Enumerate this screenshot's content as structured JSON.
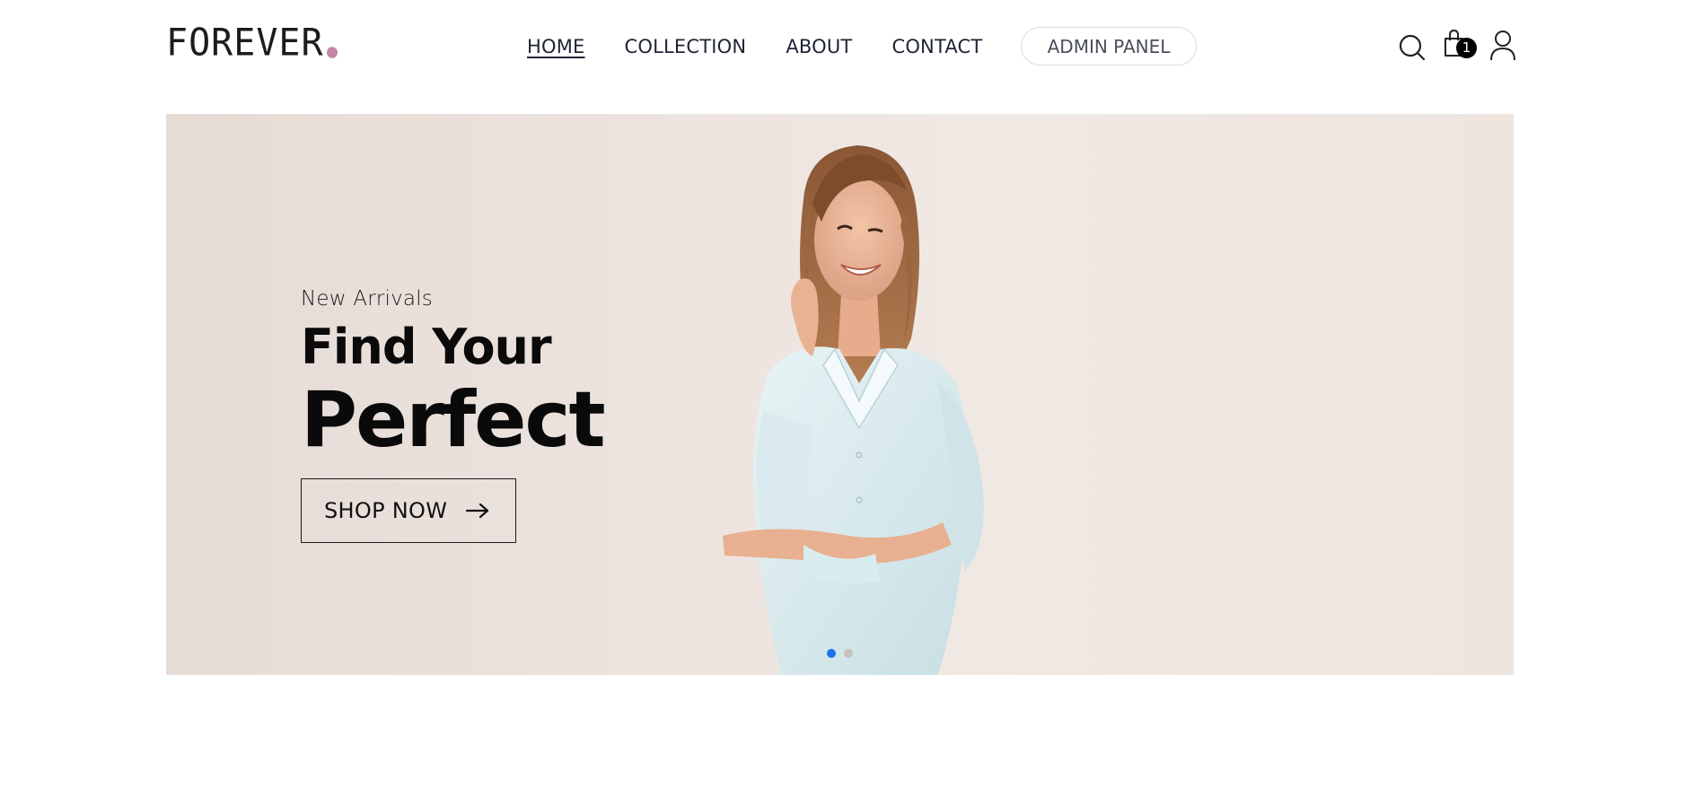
{
  "brand": {
    "name": "FOREVER",
    "dot_color": "#c586a3"
  },
  "nav": {
    "items": [
      {
        "label": "HOME",
        "active": true
      },
      {
        "label": "COLLECTION",
        "active": false
      },
      {
        "label": "ABOUT",
        "active": false
      },
      {
        "label": "CONTACT",
        "active": false
      }
    ],
    "admin_label": "ADMIN PANEL"
  },
  "header_icons": {
    "search": "search-icon",
    "cart": "shopping-bag-icon",
    "profile": "user-icon",
    "cart_count": "1"
  },
  "hero": {
    "subtitle": "New Arrivals",
    "title_line1": "Find Your",
    "title_line2": "Perfect",
    "cta_label": "SHOP NOW",
    "cta_icon": "arrow-right-icon",
    "image": "smiling-woman-light-blue-shirt",
    "carousel": {
      "slide_count": 2,
      "active_index": 0,
      "active_color": "#1a73e8",
      "inactive_color": "#c8c2bd"
    }
  }
}
